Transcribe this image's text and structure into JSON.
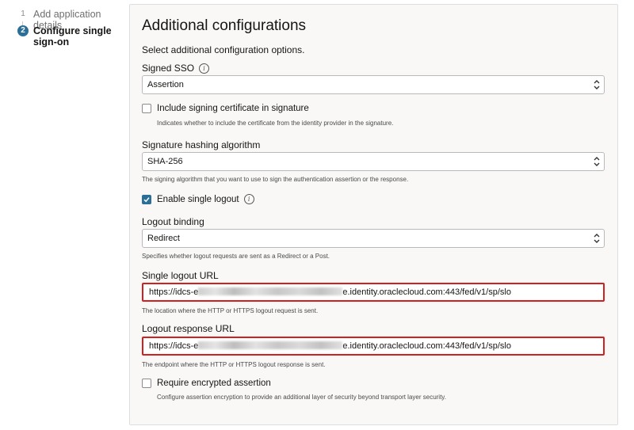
{
  "steps": [
    {
      "number": "1",
      "label": "Add application details"
    },
    {
      "number": "2",
      "label": "Configure single sign-on"
    }
  ],
  "panel": {
    "title": "Additional configurations",
    "subtitle": "Select additional configuration options."
  },
  "signed_sso": {
    "label": "Signed SSO",
    "value": "Assertion"
  },
  "include_signing_certificate": {
    "label": "Include signing certificate in signature",
    "help": "Indicates whether to include the certificate from the identity provider in the signature.",
    "checked": false
  },
  "signature_hashing": {
    "label": "Signature hashing algorithm",
    "value": "SHA-256",
    "help": "The signing algorithm that you want to use to sign the authentication assertion or the response."
  },
  "enable_single_logout": {
    "label": "Enable single logout",
    "checked": true
  },
  "logout_binding": {
    "label": "Logout binding",
    "value": "Redirect",
    "help": "Specifies whether logout requests are sent as a Redirect or a Post."
  },
  "single_logout_url": {
    "label": "Single logout URL",
    "value_prefix": "https://idcs-e",
    "value_suffix": "e.identity.oraclecloud.com:443/fed/v1/sp/slo",
    "help": "The location where the HTTP or HTTPS logout request is sent."
  },
  "logout_response_url": {
    "label": "Logout response URL",
    "value_prefix": "https://idcs-e",
    "value_suffix": "e.identity.oraclecloud.com:443/fed/v1/sp/slo",
    "help": "The endpoint where the HTTP or HTTPS logout response is sent."
  },
  "require_encrypted_assertion": {
    "label": "Require encrypted assertion",
    "help": "Configure assertion encryption to provide an additional layer of security beyond transport layer security.",
    "checked": false
  },
  "colors": {
    "accent": "#2b6f98",
    "highlight": "#d21f1f"
  },
  "icons": [
    "info-icon",
    "chevron-updown-icon",
    "checkmark-icon"
  ]
}
